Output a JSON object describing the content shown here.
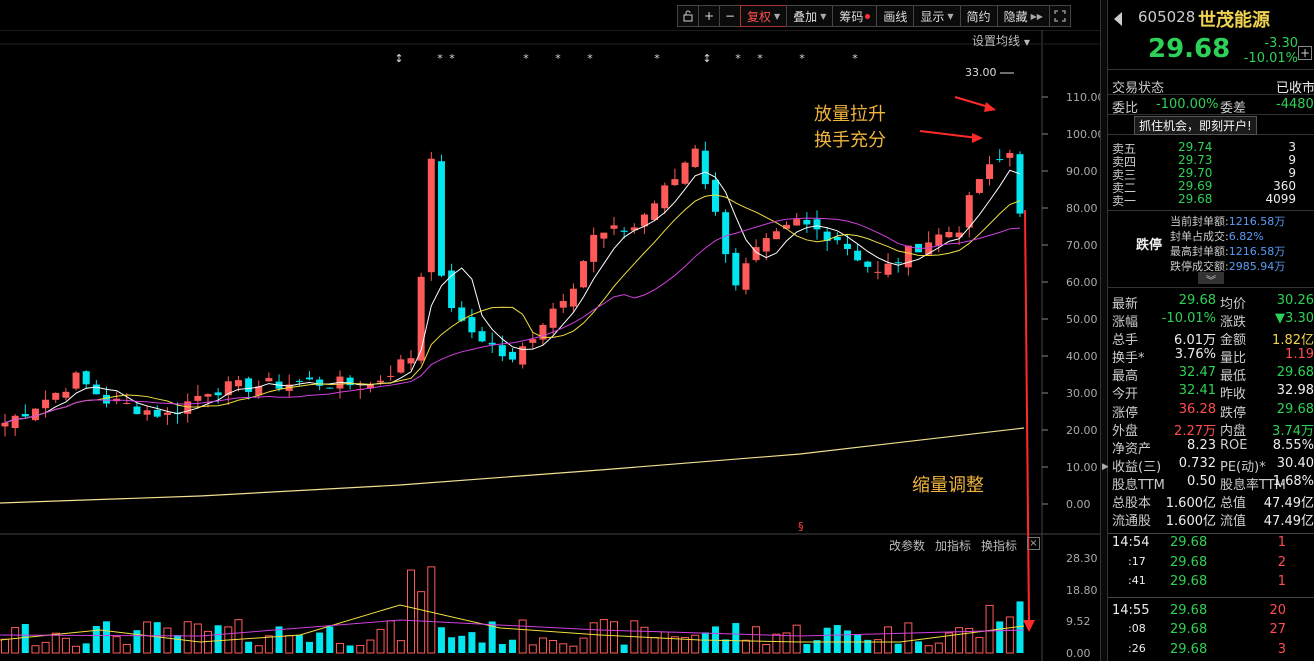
{
  "toolbar": {
    "lock_icon": "lock-icon",
    "zoom_in": "+",
    "zoom_out": "−",
    "fuquan": "复权",
    "diejia": "叠加",
    "chouma": "筹码",
    "huaxian": "画线",
    "xianshi": "显示",
    "jianyue": "简约",
    "yincang": "隐藏",
    "expand_icon": "fullscreen-icon"
  },
  "chart": {
    "ma_setting": "设置均线",
    "sub_tools": [
      "改参数",
      "加指标",
      "换指标"
    ],
    "annotation_1": [
      "放量拉升",
      "换手充分"
    ],
    "annotation_2": "缩量调整",
    "high_marker": "33.00",
    "colors": {
      "up": "#ff5a5a",
      "down": "#00e5ee",
      "ma5": "#ffffff",
      "ma10": "#f0e040",
      "ma20": "#d040e0",
      "ma250": "#f0e090"
    }
  },
  "chart_data": {
    "type": "candlestick",
    "price_axis_labels": [
      "110.00",
      "100.00",
      "90.00",
      "80.00",
      "70.00",
      "60.00",
      "50.00",
      "40.00",
      "30.00",
      "20.00",
      "10.00",
      "0.00"
    ],
    "price_axis_values": [
      110,
      100,
      90,
      80,
      70,
      60,
      50,
      40,
      30,
      20,
      10,
      0
    ],
    "volume_axis_labels": [
      "28.30",
      "18.80",
      "9.52",
      "0.00"
    ],
    "volume_axis_values": [
      28.3,
      18.8,
      9.52,
      0
    ],
    "last_high": 33.0,
    "events": [
      "+",
      "**",
      "*",
      "*",
      "*",
      "**",
      "+",
      "*",
      "*",
      "*",
      "*"
    ]
  },
  "quote": {
    "code": "605028",
    "name": "世茂能源",
    "price": "29.68",
    "change": "-3.30",
    "change_pct": "-10.01%",
    "status_label": "交易状态",
    "status_value": "已收市",
    "weibi_label": "委比",
    "weibi_value": "-100.00%",
    "weicha_label": "委差",
    "weicha_value": "-4480",
    "promo": "抓住机会，即刻开户!",
    "asks": [
      {
        "label": "卖五",
        "price": "29.74",
        "vol": "3"
      },
      {
        "label": "卖四",
        "price": "29.73",
        "vol": "9"
      },
      {
        "label": "卖三",
        "price": "29.70",
        "vol": "9"
      },
      {
        "label": "卖二",
        "price": "29.69",
        "vol": "360"
      },
      {
        "label": "卖一",
        "price": "29.68",
        "vol": "4099"
      }
    ],
    "limit_title": "跌停",
    "limit_rows": [
      {
        "label": "当前封单额:",
        "value": "1216.58万"
      },
      {
        "label": "封单占成交:",
        "value": "6.82%"
      },
      {
        "label": "最高封单额:",
        "value": "1216.58万"
      },
      {
        "label": "跌停成交额:",
        "value": "2985.94万"
      }
    ],
    "stats": [
      {
        "l1": "最新",
        "v1": "29.68",
        "c1": "g",
        "l2": "均价",
        "v2": "30.26",
        "c2": "g"
      },
      {
        "l1": "涨幅",
        "v1": "-10.01%",
        "c1": "g",
        "l2": "涨跌",
        "v2": "▼3.30",
        "c2": "g"
      },
      {
        "l1": "总手",
        "v1": "6.01万",
        "c1": "w",
        "l2": "金额",
        "v2": "1.82亿",
        "c2": "y"
      },
      {
        "l1": "换手*",
        "v1": "3.76%",
        "c1": "w",
        "l2": "量比",
        "v2": "1.19",
        "c2": "r"
      },
      {
        "l1": "最高",
        "v1": "32.47",
        "c1": "g",
        "l2": "最低",
        "v2": "29.68",
        "c2": "g"
      },
      {
        "l1": "今开",
        "v1": "32.41",
        "c1": "g",
        "l2": "昨收",
        "v2": "32.98",
        "c2": "w"
      },
      {
        "l1": "涨停",
        "v1": "36.28",
        "c1": "r",
        "l2": "跌停",
        "v2": "29.68",
        "c2": "g"
      },
      {
        "l1": "外盘",
        "v1": "2.27万",
        "c1": "r",
        "l2": "内盘",
        "v2": "3.74万",
        "c2": "g"
      },
      {
        "l1": "净资产",
        "v1": "8.23",
        "c1": "w",
        "l2": "ROE",
        "v2": "8.55%",
        "c2": "w"
      },
      {
        "l1": "收益(三)",
        "v1": "0.732",
        "c1": "w",
        "l2": "PE(动)*",
        "v2": "30.40",
        "c2": "w"
      },
      {
        "l1": "股息TTM",
        "v1": "0.50",
        "c1": "w",
        "l2": "股息率TTM",
        "v2": "1.68%",
        "c2": "w"
      },
      {
        "l1": "总股本",
        "v1": "1.600亿",
        "c1": "w",
        "l2": "总值",
        "v2": "47.49亿",
        "c2": "w"
      },
      {
        "l1": "流通股",
        "v1": "1.600亿",
        "c1": "w",
        "l2": "流值",
        "v2": "47.49亿",
        "c2": "w"
      }
    ],
    "ticks": [
      {
        "time": "14:54",
        "price": "29.68",
        "vol": "1"
      },
      {
        "time": ":17",
        "price": "29.68",
        "vol": "2"
      },
      {
        "time": ":41",
        "price": "29.68",
        "vol": "1"
      },
      {
        "time": "14:55",
        "price": "29.68",
        "vol": "20"
      },
      {
        "time": ":08",
        "price": "29.68",
        "vol": "27"
      },
      {
        "time": ":26",
        "price": "29.68",
        "vol": "3"
      }
    ]
  }
}
